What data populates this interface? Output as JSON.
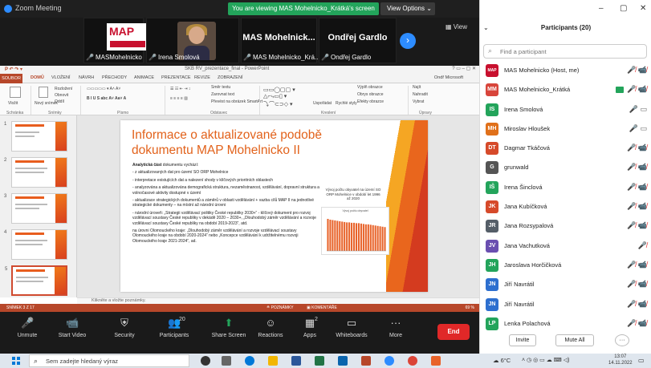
{
  "window": {
    "app_title": "Zoom Meeting",
    "viewing_banner": "You are viewing MAS Mohelnicko_Krátká's screen",
    "view_options": "View Options ⌄",
    "view_label": "▦ View"
  },
  "video_tiles": [
    {
      "name": "MASMohelnicko",
      "big": ""
    },
    {
      "name": "Irena Smolová",
      "big": ""
    },
    {
      "name": "MAS Mohelnicko_Krá...",
      "big": "MAS Mohelnick..."
    },
    {
      "name": "Ondřej Gardlo",
      "big": "Ondřej Gardlo"
    }
  ],
  "map_logo_text": "MAP",
  "ppt": {
    "doc_title": "SKB RV_prezentace_final - PowerPoint",
    "signin": "Ondř Microsoft",
    "tabs": [
      "SOUBOR",
      "DOMŮ",
      "VLOŽENÍ",
      "NÁVRH",
      "PŘECHODY",
      "ANIMACE",
      "PREZENTACE",
      "REVIZE",
      "ZOBRAZENÍ"
    ],
    "ribbon_groups": [
      "Schránka",
      "Snímky",
      "Písmo",
      "Odstavec",
      "Kreslení",
      "Úpravy"
    ],
    "ribbon_items": [
      "Vložit",
      "Nový snímek",
      "Rozložení",
      "Obnovit",
      "Oddíl",
      "Směr textu",
      "Zarovnat text",
      "Převést na obrázek SmartArt",
      "Uspořádat",
      "Rychlé styly",
      "Výplň obrazce",
      "Obrys obrazce",
      "Efekty obrazce",
      "Najít",
      "Nahradit",
      "Vybrat"
    ],
    "slide": {
      "title": "Informace o aktualizované podobě dokumentu MAP Mohelnicko II",
      "heading_bold": "Analytická část",
      "heading_rest": " dokumentu vychází:",
      "bullets": [
        "- z aktualizovaných dat pro území SO ORP Mohelnice",
        "- interpretace existujících dat a nalezení shody v klíčových prioritních oblastech",
        "- analyzována a aktualizována demografická struktura, nezaměstnanost, vzdělávání, dopravní struktura a volnočasové aktivity dostupné v území",
        "- aktualizace strategických dokumentů a záměrů v oblasti vzdělávání + vazba cílů MAP II na jednotlivé strategické dokumenty – na místní až národní úrovni"
      ],
      "national": "- národní úroveň: „Strategii vzdělávací politiky České republiky 2030+“ - klíčový dokument pro rozvoj vzdělávací soustavy České republiky v dekádě 2020 – 2030+, „Dlouhodobý záměr vzdělávání a rozvoje vzdělávací soustavy České republiky na období 2019-2023“, atd.",
      "regional": "na úrovni Olomouckého kraje: „Dlouhodobý záměr vzdělávání a rozvoje vzdělávací soustavy Olomouckého kraje na období 2020-2024“ nebo „Koncepce vzdělávání k udržitelnému rozvoji Olomouckého kraje 2021-2024“, ad.",
      "chart_caption": "Vývoj počtu obyvatel na území SO ORP Mohelnice v období let 1996 až 2020",
      "chart_inner_title": "Vývoj počtu obyvatel"
    },
    "notes_placeholder": "Klikněte a vložte poznámky.",
    "status_left": "SNÍMEK 3 Z 17",
    "status_notes": "≙ POZNÁMKY",
    "status_comments": "▣ KOMENTÁŘE",
    "status_zoom": "69 %"
  },
  "chart_data": {
    "type": "bar",
    "title": "Vývoj počtu obyvatel",
    "values": [
      82,
      80,
      79,
      78,
      77,
      76,
      75,
      74,
      73,
      73,
      72,
      72,
      71,
      71,
      70,
      69,
      68,
      68,
      67,
      66,
      65,
      64,
      63,
      62,
      61
    ],
    "bar_color": "#e8632a"
  },
  "toolbar": {
    "unmute": "Unmute",
    "start_video": "Start Video",
    "security": "Security",
    "participants": "Participants",
    "participants_count": "20",
    "share_screen": "Share Screen",
    "reactions": "Reactions",
    "apps": "Apps",
    "apps_count": "2",
    "whiteboards": "Whiteboards",
    "more": "More",
    "end": "End"
  },
  "panel": {
    "title": "Participants (20)",
    "search_placeholder": "Find a participant",
    "participants": [
      {
        "initials": "MAP",
        "color": "#c8102e",
        "name": "MAS Mohelnicko (Host, me)",
        "icons": "🎤̸ 📹̸"
      },
      {
        "initials": "MM",
        "color": "#d8453b",
        "name": "MAS Mohelnicko_Krátká",
        "icons": "🎤̸ 📹̸",
        "sharing": true
      },
      {
        "initials": "IS",
        "color": "#23a45b",
        "name": "Irena Smolová",
        "icons": "🎤 ▭"
      },
      {
        "initials": "MH",
        "color": "#e0701a",
        "name": "Miroslav Hloušek",
        "icons": "🎤 ▭"
      },
      {
        "initials": "DT",
        "color": "#d64a2a",
        "name": "Dagmar Tkáčová",
        "icons": "🎤̸ 📹̸"
      },
      {
        "initials": "G",
        "color": "#555555",
        "name": "grunwald",
        "icons": "🎤̸ 📹̸"
      },
      {
        "initials": "IŠ",
        "color": "#23a45b",
        "name": "Irena Šinclová",
        "icons": "🎤̸ 📹̸"
      },
      {
        "initials": "JK",
        "color": "#d64a2a",
        "name": "Jana Kubíčková",
        "icons": "🎤̸ 📹̸"
      },
      {
        "initials": "JR",
        "color": "#555e68",
        "name": "Jana Rozsypalová",
        "icons": "🎤̸ 📹̸"
      },
      {
        "initials": "JV",
        "color": "#6a4fb0",
        "name": "Jana Vachutková",
        "icons": "🎤̸"
      },
      {
        "initials": "JH",
        "color": "#23a45b",
        "name": "Jaroslava Horčičková",
        "icons": "🎤̸ 📹̸"
      },
      {
        "initials": "JN",
        "color": "#2d6fcf",
        "name": "Jiří Navrátil",
        "icons": "🎤̸ 📹̸"
      },
      {
        "initials": "JN",
        "color": "#2d6fcf",
        "name": "Jiří Navrátil",
        "icons": "🎤̸ 📹̸"
      },
      {
        "initials": "LP",
        "color": "#23a45b",
        "name": "Lenka Polachová",
        "icons": "🎤̸ 📹̸"
      }
    ],
    "invite": "Invite",
    "mute_all": "Mute All",
    "more": "···"
  },
  "taskbar": {
    "search_placeholder": "Sem zadejte hledaný výraz",
    "weather": "6°C",
    "time": "13:07",
    "date": "14.11.2022"
  }
}
